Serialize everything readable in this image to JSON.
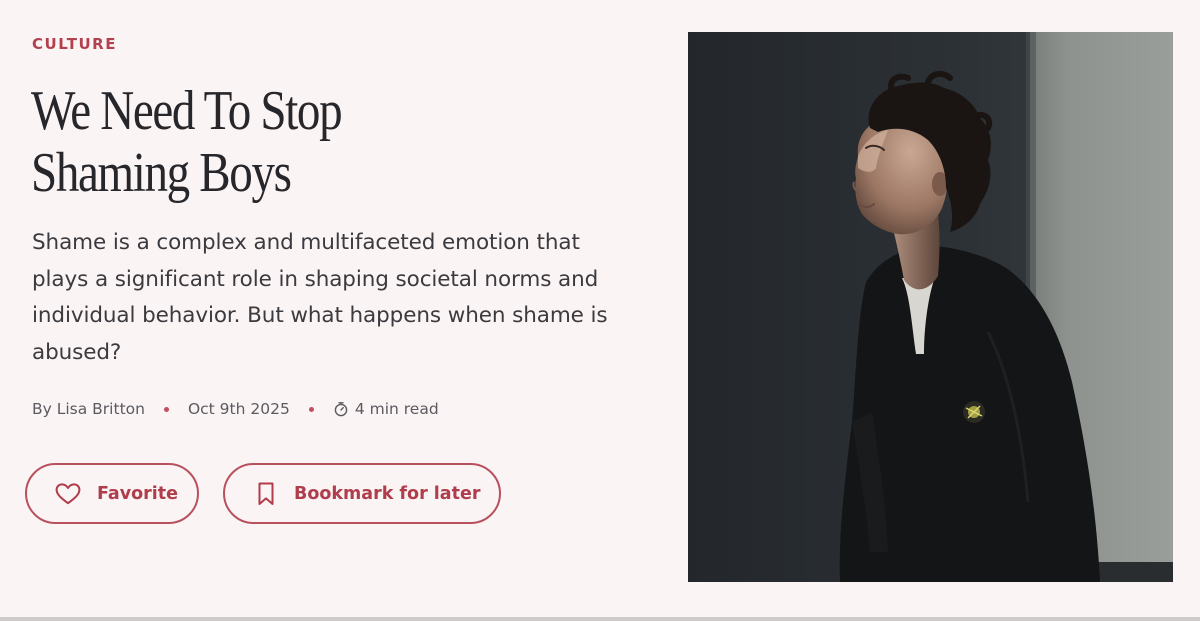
{
  "article": {
    "category": "CULTURE",
    "title_lines": [
      "We Need To Stop",
      "Shaming Boys"
    ],
    "dek": "Shame is a complex and multifaceted emotion that plays a significant role in shaping societal norms and individual behavior. But what happens when shame is abused?",
    "byline": "By Lisa Britton",
    "date": "Oct 9th 2025",
    "read_time": "4 min read"
  },
  "actions": {
    "favorite_label": "Favorite",
    "bookmark_label": "Bookmark for later"
  },
  "icons": {
    "timer": "stopwatch-icon",
    "favorite": "heart-icon",
    "bookmark": "bookmark-icon"
  },
  "colors": {
    "background": "#fbf4f4",
    "accent": "#b3404f",
    "text": "#26262b",
    "meta_text": "#5a5a60"
  }
}
